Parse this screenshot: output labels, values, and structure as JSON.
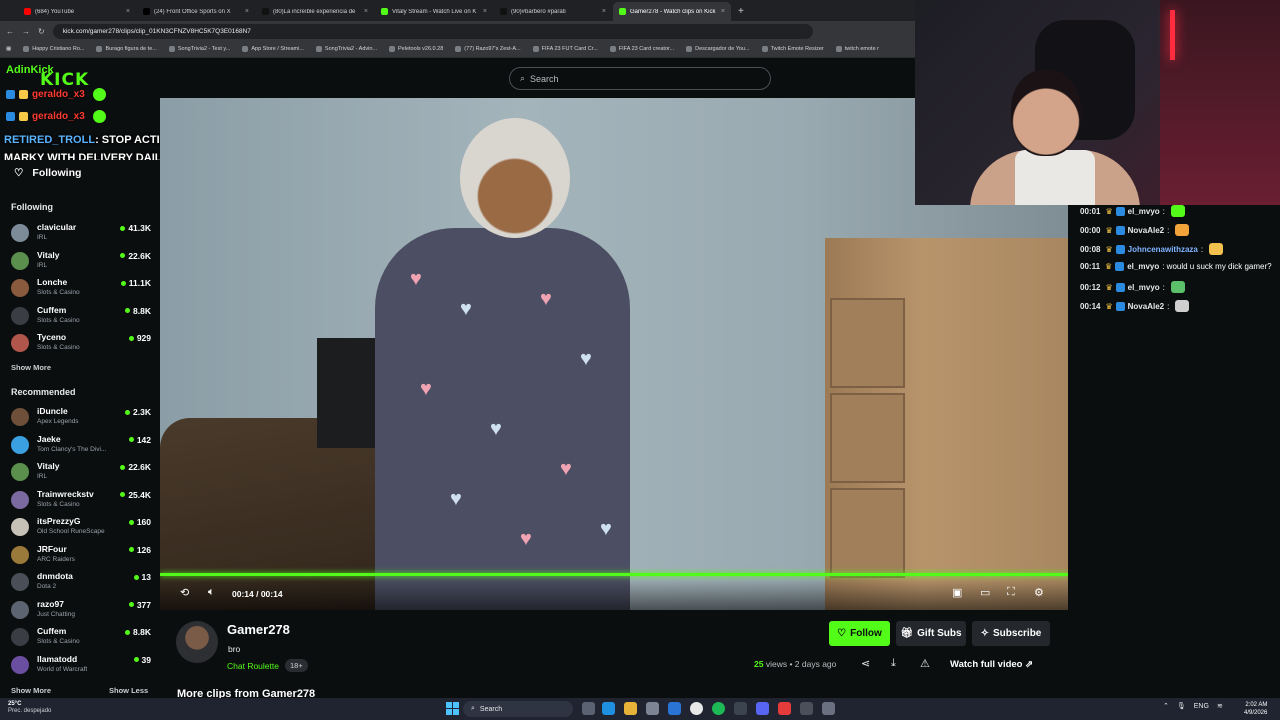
{
  "browser": {
    "tabs": [
      {
        "label": "(684) YouTube",
        "color": "#ff0000"
      },
      {
        "label": "(24) Front Office Sports on X",
        "color": "#000000"
      },
      {
        "label": "(80)La increíble experiencia de",
        "color": "#111111"
      },
      {
        "label": "Vitaly Stream - Watch Live on K",
        "color": "#53fc18"
      },
      {
        "label": "(90)#barbero #parati",
        "color": "#111111"
      },
      {
        "label": "Gamer278 - Watch clips on Kick",
        "color": "#53fc18"
      }
    ],
    "new_tab": "+",
    "url": "kick.com/gamer278/clips/clip_01KN3CFNZV8HC5K7Q3E0168N7",
    "bookmarks": [
      "Happy Cristiano Ro...",
      "Burago figura de te...",
      "SongTrivia2 - Test y...",
      "App Store / Streami...",
      "SongTrivia2 - Advin...",
      "Peletools v26.0.28",
      "(77) Razo97's Zest-A...",
      "FIFA 23 FUT Card Cr...",
      "FIFA 23 Card creator...",
      "Descargador de You...",
      "Twitch Emote Resizer",
      "twitch emote r"
    ]
  },
  "header": {
    "search_placeholder": "Search"
  },
  "overlay": {
    "streamer_tag": "AdinKick",
    "logo_text": "KICK",
    "chat_users": [
      "geraldo_x3",
      "geraldo_x3"
    ],
    "message_user": "RETIRED_TROLL",
    "message_text": ": STOP ACTING LIKE MARKY WITH DELIVERY DAILY"
  },
  "sidebar": {
    "following_nav": "Following",
    "following_header": "Following",
    "following": [
      {
        "name": "clavicular",
        "category": "IRL",
        "viewers": "41.3K",
        "color": "#7d8b99"
      },
      {
        "name": "Vitaly",
        "category": "IRL",
        "viewers": "22.6K",
        "color": "#5a8f4d"
      },
      {
        "name": "Lonche",
        "category": "Slots & Casino",
        "viewers": "11.1K",
        "color": "#8a5a3e"
      },
      {
        "name": "Cuffem",
        "category": "Slots & Casino",
        "viewers": "8.8K",
        "color": "#3a3d44"
      },
      {
        "name": "Tyceno",
        "category": "Slots & Casino",
        "viewers": "929",
        "color": "#b0564a"
      }
    ],
    "show_more_1": "Show More",
    "recommended_header": "Recommended",
    "recommended": [
      {
        "name": "iDuncle",
        "category": "Apex Legends",
        "viewers": "2.3K",
        "color": "#6e4f3a"
      },
      {
        "name": "Jaeke",
        "category": "Tom Clancy's The Divi...",
        "viewers": "142",
        "color": "#3aa0e0"
      },
      {
        "name": "Vitaly",
        "category": "IRL",
        "viewers": "22.6K",
        "color": "#5a8f4d"
      },
      {
        "name": "Trainwreckstv",
        "category": "Slots & Casino",
        "viewers": "25.4K",
        "color": "#7a6aa0"
      },
      {
        "name": "itsPrezzyG",
        "category": "Old School RuneScape",
        "viewers": "160",
        "color": "#c7c2b8"
      },
      {
        "name": "JRFour",
        "category": "ARC Raiders",
        "viewers": "126",
        "color": "#9a7a3a"
      },
      {
        "name": "dnmdota",
        "category": "Dota 2",
        "viewers": "13",
        "color": "#4a4f57"
      },
      {
        "name": "razo97",
        "category": "Just Chatting",
        "viewers": "377",
        "color": "#5b6470"
      },
      {
        "name": "Cuffem",
        "category": "Slots & Casino",
        "viewers": "8.8K",
        "color": "#3a3d44"
      },
      {
        "name": "llamatodd",
        "category": "World of Warcraft",
        "viewers": "39",
        "color": "#6a4fa0"
      }
    ],
    "show_more_2": "Show More",
    "show_less": "Show Less"
  },
  "player": {
    "time": "00:14 / 00:14",
    "progress_fraction": 1.0
  },
  "clip": {
    "channel": "Gamer278",
    "title": "bro",
    "category": "Chat Roulette",
    "age_tag": "18+",
    "views_count": "25",
    "views_rest": " views • 2 days ago",
    "follow": "Follow",
    "gift": "Gift Subs",
    "subscribe": "Subscribe",
    "watch_full": "Watch full video",
    "more_clips": "More clips from Gamer278"
  },
  "chat": {
    "messages": [
      {
        "time": "00:01",
        "user": "el_mvyo",
        "text": ":",
        "user_color": "#e6e8ea",
        "emote": "#53fc18"
      },
      {
        "time": "00:00",
        "user": "NovaAle2",
        "text": ":",
        "user_color": "#e6e8ea",
        "emote": "#f2a33a"
      },
      {
        "time": "00:08",
        "user": "Johncenawithzaza",
        "text": ":",
        "user_color": "#7fb3ff",
        "emote": "#f2c14e"
      },
      {
        "time": "00:11",
        "user": "el_mvyo",
        "text": ": would u suck my dick gamer?",
        "user_color": "#e6e8ea",
        "emote": ""
      },
      {
        "time": "00:12",
        "user": "el_mvyo",
        "text": ":",
        "user_color": "#e6e8ea",
        "emote": "#5cbf6a"
      },
      {
        "time": "00:14",
        "user": "NovaAle2",
        "text": ":",
        "user_color": "#e6e8ea",
        "emote": "#cfcfcf"
      }
    ]
  },
  "taskbar": {
    "weather_temp": "25°C",
    "weather_desc": "Prec. despejado",
    "search": "Search",
    "lang": "ENG",
    "time": "2:02 AM",
    "date": "4/9/2026"
  }
}
